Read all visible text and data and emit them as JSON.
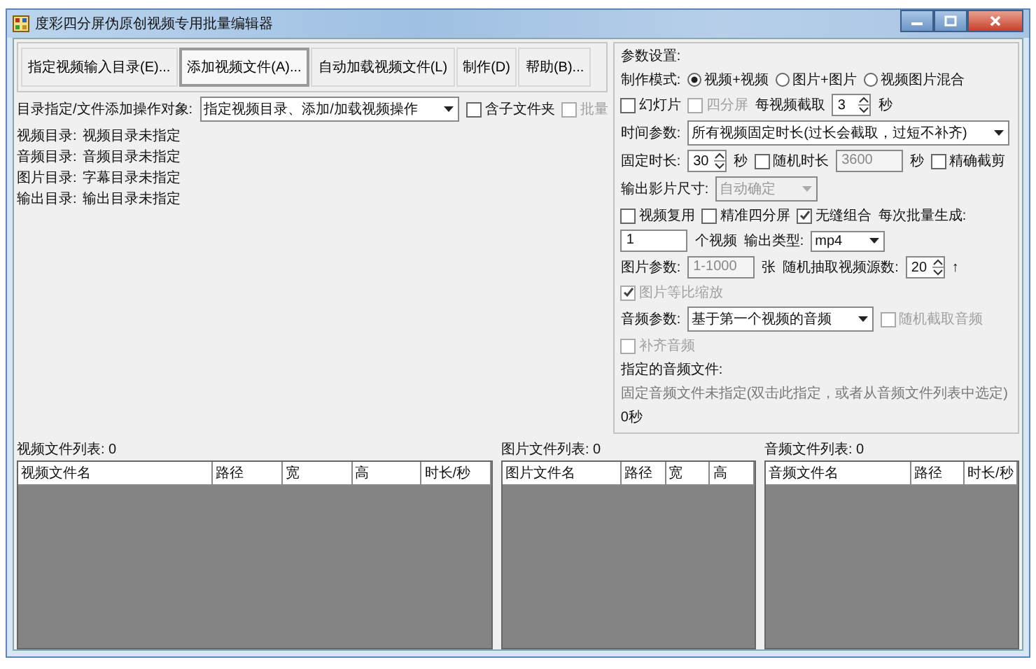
{
  "window": {
    "title": "度彩四分屏伪原创视频专用批量编辑器"
  },
  "toolbar": [
    {
      "label": "指定视频输入目录(E)...",
      "focused": false
    },
    {
      "label": "添加视频文件(A)...",
      "focused": true
    },
    {
      "label": "自动加载视频文件(L)",
      "focused": false
    },
    {
      "label": "制作(D)",
      "focused": false
    },
    {
      "label": "帮助(B)...",
      "focused": false
    }
  ],
  "target": {
    "label": "目录指定/文件添加操作对象:",
    "value": "指定视频目录、添加/加载视频操作",
    "options": [
      {
        "label": "含子文件夹",
        "checked": false,
        "disabled": false
      },
      {
        "label": "批量",
        "checked": false,
        "disabled": true
      }
    ]
  },
  "directories": [
    {
      "label": "视频目录:",
      "value": "视频目录未指定"
    },
    {
      "label": "音频目录:",
      "value": "音频目录未指定"
    },
    {
      "label": "图片目录:",
      "value": "字幕目录未指定"
    },
    {
      "label": "输出目录:",
      "value": "输出目录未指定"
    }
  ],
  "video_list": {
    "title": "视频文件列表: 0",
    "columns": [
      "视频文件名",
      "路径",
      "宽",
      "高",
      "时长/秒"
    ]
  },
  "params": {
    "title": "参数设置:",
    "rows": [
      {
        "items": [
          {
            "kind": "label",
            "text": "制作模式:"
          },
          {
            "kind": "radio",
            "label": "视频+视频",
            "selected": true
          },
          {
            "kind": "radio",
            "label": "图片+图片",
            "selected": false
          },
          {
            "kind": "radio",
            "label": "视频图片混合",
            "selected": false
          },
          {
            "kind": "checkbox",
            "label": "幻灯片",
            "checked": false,
            "disabled": false
          },
          {
            "kind": "checkbox",
            "label": "四分屏",
            "checked": false,
            "disabled": true
          },
          {
            "kind": "label",
            "text": "每视频截取"
          },
          {
            "kind": "spin",
            "value": "3",
            "disabled": false
          },
          {
            "kind": "label",
            "text": "秒"
          }
        ]
      },
      {
        "items": [
          {
            "kind": "label",
            "text": "时间参数:"
          },
          {
            "kind": "combo",
            "value": "所有视频固定时长(过长会截取，过短不补齐)",
            "disabled": false
          }
        ]
      },
      {
        "items": [
          {
            "kind": "label",
            "text": "固定时长:"
          },
          {
            "kind": "spin",
            "value": "30",
            "disabled": false
          },
          {
            "kind": "label",
            "text": "秒"
          },
          {
            "kind": "checkbox",
            "label": "随机时长",
            "checked": false,
            "disabled": false
          },
          {
            "kind": "input",
            "value": "3600",
            "disabled": true
          },
          {
            "kind": "label",
            "text": "秒"
          },
          {
            "kind": "checkbox",
            "label": "精确截剪",
            "checked": false,
            "disabled": false
          },
          {
            "kind": "label",
            "text": "输出影片尺寸:"
          },
          {
            "kind": "combo",
            "value": "自动确定",
            "disabled": true
          }
        ]
      },
      {
        "items": [
          {
            "kind": "checkbox",
            "label": "视频复用",
            "checked": false,
            "disabled": false
          },
          {
            "kind": "checkbox",
            "label": "精准四分屏",
            "checked": false,
            "disabled": false
          },
          {
            "kind": "checkbox",
            "label": "无缝组合",
            "checked": true,
            "disabled": false
          },
          {
            "kind": "label",
            "text": "每次批量生成:"
          },
          {
            "kind": "input",
            "value": "1",
            "disabled": false
          },
          {
            "kind": "label",
            "text": "个视频"
          },
          {
            "kind": "label",
            "text": "输出类型:"
          },
          {
            "kind": "combo",
            "value": "mp4",
            "disabled": false
          }
        ]
      },
      {
        "items": [
          {
            "kind": "label",
            "text": "图片参数:"
          },
          {
            "kind": "input",
            "value": "1-1000",
            "disabled": true
          },
          {
            "kind": "label",
            "text": "张"
          },
          {
            "kind": "label",
            "text": "随机抽取视频源数:"
          },
          {
            "kind": "spin",
            "value": "20",
            "disabled": false
          },
          {
            "kind": "label",
            "text": "↑"
          },
          {
            "kind": "checkbox",
            "label": "图片等比缩放",
            "checked": true,
            "disabled": true
          }
        ]
      },
      {
        "items": [
          {
            "kind": "label",
            "text": "音频参数:"
          },
          {
            "kind": "combo",
            "value": "基于第一个视频的音频",
            "disabled": false
          },
          {
            "kind": "checkbox",
            "label": "随机截取音频",
            "checked": false,
            "disabled": true
          },
          {
            "kind": "checkbox",
            "label": "补齐音频",
            "checked": false,
            "disabled": true
          }
        ]
      },
      {
        "items": [
          {
            "kind": "label",
            "text": "指定的音频文件:"
          },
          {
            "kind": "note",
            "text": "固定音频文件未指定(双击此指定，或者从音频文件列表中选定)"
          },
          {
            "kind": "label",
            "text": "0秒"
          }
        ]
      }
    ]
  },
  "image_list": {
    "title": "图片文件列表: 0",
    "columns": [
      "图片文件名",
      "路径",
      "宽",
      "高"
    ]
  },
  "audio_list": {
    "title": "音频文件列表: 0",
    "columns": [
      "音频文件名",
      "路径",
      "时长/秒"
    ]
  }
}
